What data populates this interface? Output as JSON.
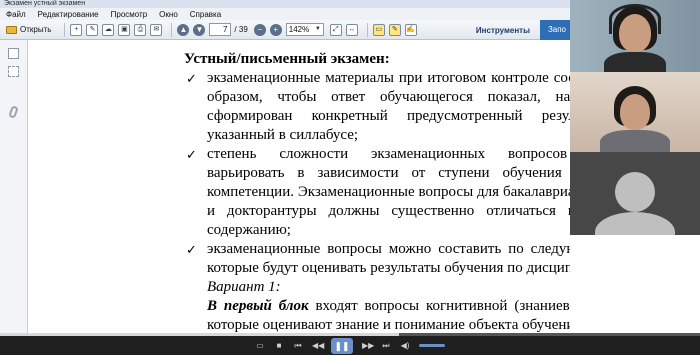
{
  "window": {
    "title": "Экзамен устный экзамен"
  },
  "menu": [
    "Файл",
    "Редактирование",
    "Просмотр",
    "Окно",
    "Справка"
  ],
  "toolbar": {
    "open_label": "Открыть",
    "page_current": "7",
    "page_total": "/ 39",
    "zoom": "142%",
    "tools_label": "Инструменты",
    "share_label": "Запо"
  },
  "document": {
    "heading": "Устный/письменный экзамен:",
    "bullets": [
      "экзаменационные материалы при итоговом контроле составляются таким образом, чтобы ответ обучающегося показал, насколько у него сформирован конкретный предусмотренный результат обучения, указанный в силлабусе;",
      "степень сложности экзаменационных вопросов ре­комендуется варьировать в зависимости от ступени обучения и формируемой компетенции. Экзаменационные вопросы для бакалавриата, магистратуры и докторантуры должны существенно отличаться по сложности и содержанию;",
      "экзаменационные вопросы можно составить по следующим вариантам, которые будут оценивать результаты обучения по дисциплине:"
    ],
    "variant_title": "Вариант 1:",
    "variant_bold": "В первый блок",
    "variant_text": " входят вопросы когнитивной (знаниевой) компетенции, которые оценивают знание и понимание объекта обучения;"
  },
  "media": {
    "progress": 0.57,
    "accent": "#6b8fc7",
    "icons": [
      "cc-icon",
      "stop-icon",
      "skip-back-icon",
      "rewind-icon",
      "pause-icon",
      "forward-icon",
      "skip-forward-icon",
      "volume-icon"
    ]
  }
}
